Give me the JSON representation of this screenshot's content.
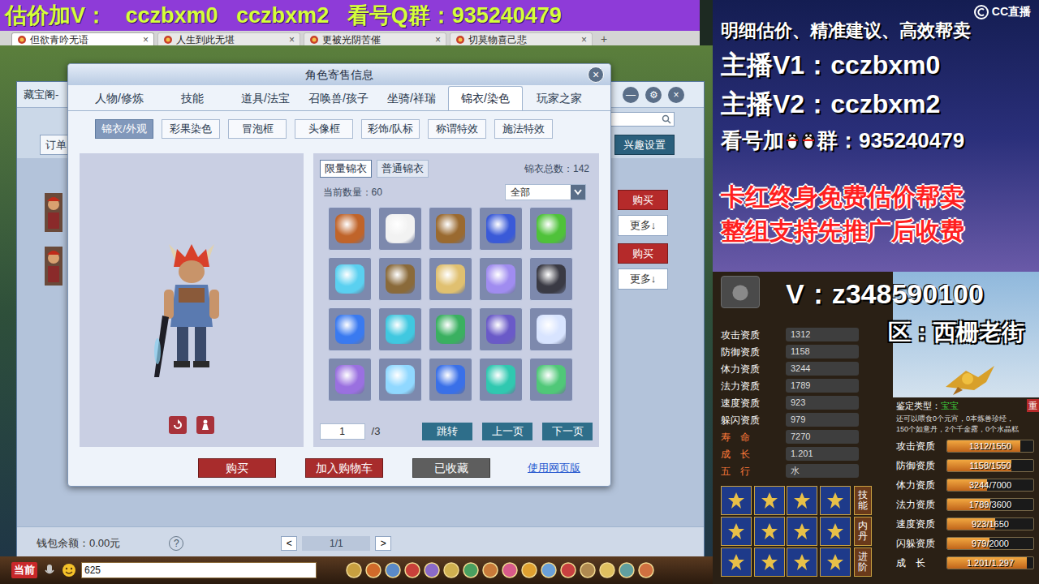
{
  "banner": "估价加V：   cczbxm0   cczbxm2   看号Q群：935240479",
  "browser_tabs": [
    {
      "label": "但欲青吟无语",
      "close": "×",
      "selected": true
    },
    {
      "label": "人生到此无堪",
      "close": "×",
      "selected": false
    },
    {
      "label": "更被光阴苦催",
      "close": "×",
      "selected": false
    },
    {
      "label": "切莫物喜己悲",
      "close": "×",
      "selected": false
    }
  ],
  "new_tab": "+",
  "trade_window": {
    "title": "藏宝阁-",
    "controls": [
      "—",
      "⚙",
      "×"
    ],
    "order": "订单",
    "interest": "兴趣设置",
    "listings": [
      {
        "buy": "购买",
        "more": "更多↓"
      },
      {
        "buy": "购买",
        "more": "更多↓"
      }
    ],
    "wallet": "钱包余额：0.00元",
    "help": "?",
    "pager": {
      "prev": "<",
      "page": "1/1",
      "next": ">"
    }
  },
  "dialog": {
    "title": "角色寄售信息",
    "close": "×",
    "tabs": [
      {
        "label": "人物/修炼",
        "selected": false
      },
      {
        "label": "技能",
        "selected": false
      },
      {
        "label": "道具/法宝",
        "selected": false
      },
      {
        "label": "召唤兽/孩子",
        "selected": false
      },
      {
        "label": "坐骑/祥瑞",
        "selected": false
      },
      {
        "label": "锦衣/染色",
        "selected": true
      },
      {
        "label": "玩家之家",
        "selected": false
      }
    ],
    "subtabs": [
      {
        "label": "锦衣/外观",
        "selected": true
      },
      {
        "label": "彩果染色",
        "selected": false
      },
      {
        "label": "冒泡框",
        "selected": false
      },
      {
        "label": "头像框",
        "selected": false
      },
      {
        "label": "彩饰/队标",
        "selected": false
      },
      {
        "label": "称谓特效",
        "selected": false
      },
      {
        "label": "施法特效",
        "selected": false
      }
    ],
    "outfit_types": [
      {
        "label": "限量锦衣",
        "selected": true
      },
      {
        "label": "普通锦衣",
        "selected": false
      }
    ],
    "total": "锦衣总数：142",
    "current": "当前数量：60",
    "filter": "全部",
    "items": [
      {
        "color": "#c0642a"
      },
      {
        "color": "#f2f2f2"
      },
      {
        "color": "#9a6a30"
      },
      {
        "color": "#3a5ad8"
      },
      {
        "color": "#4fc23a"
      },
      {
        "color": "#5ad0f0"
      },
      {
        "color": "#8a6a3a"
      },
      {
        "color": "#e0c070"
      },
      {
        "color": "#a08cf0"
      },
      {
        "color": "#3a3a44"
      },
      {
        "color": "#3a7af0"
      },
      {
        "color": "#40c8e0"
      },
      {
        "color": "#3ab060"
      },
      {
        "color": "#6a5ac8"
      },
      {
        "color": "#d8e4ff"
      },
      {
        "color": "#9a70e0"
      },
      {
        "color": "#90d8ff"
      },
      {
        "color": "#3a70e8"
      },
      {
        "color": "#30c8b0"
      },
      {
        "color": "#50c878"
      }
    ],
    "page_input": "1",
    "page_total": "/3",
    "jump": "跳转",
    "prev": "上一页",
    "next": "下一页",
    "actions": [
      {
        "label": "购买",
        "kind": "primary"
      },
      {
        "label": "加入购物车",
        "kind": "primary"
      },
      {
        "label": "已收藏",
        "kind": "muted"
      }
    ],
    "web_link": "使用网页版"
  },
  "taskbar": {
    "label": "当前",
    "value": "625"
  },
  "stream": {
    "logo": "CC直播",
    "headline": "明细估价、精准建议、高效帮卖",
    "anchors": [
      "主播V1：cczbxm0",
      "主播V2：cczbxm2"
    ],
    "group": {
      "prefix": "看号加",
      "suffix": "群：935240479"
    },
    "promos": [
      "卡红终身免费估价帮卖",
      "整组支持先推广后收费"
    ],
    "contact": "V：z348590100",
    "server": "区：西栅老街"
  },
  "pet": {
    "stats": [
      {
        "label": "攻击资质",
        "value": "1312",
        "kind": "aptitude"
      },
      {
        "label": "防御资质",
        "value": "1158",
        "kind": "aptitude"
      },
      {
        "label": "体力资质",
        "value": "3244",
        "kind": "aptitude"
      },
      {
        "label": "法力资质",
        "value": "1789",
        "kind": "aptitude"
      },
      {
        "label": "速度资质",
        "value": "923",
        "kind": "aptitude"
      },
      {
        "label": "躲闪资质",
        "value": "979",
        "kind": "aptitude"
      },
      {
        "label": "寿　命",
        "value": "7270",
        "kind": "basic"
      },
      {
        "label": "成　长",
        "value": "1.201",
        "kind": "basic"
      },
      {
        "label": "五　行",
        "value": "水",
        "kind": "basic"
      }
    ],
    "appraisal": {
      "label": "鉴定类型：",
      "value": "宝宝"
    },
    "corner": "重",
    "feed_lines": [
      "还可以喂食0个元宵，0本炼兽珍经，",
      "150个如意丹，2个千金露，0个水晶糕"
    ],
    "bars": [
      {
        "label": "攻击资质",
        "reading": "1312/1550",
        "level": 0.846
      },
      {
        "label": "防御资质",
        "reading": "1158/1550",
        "level": 0.747
      },
      {
        "label": "体力资质",
        "reading": "3244/7000",
        "level": 0.463
      },
      {
        "label": "法力资质",
        "reading": "1789/3600",
        "level": 0.497
      },
      {
        "label": "速度资质",
        "reading": "923/1650",
        "level": 0.559
      },
      {
        "label": "闪躲资质",
        "reading": "979/2000",
        "level": 0.49
      },
      {
        "label": "成　长",
        "reading": "1.201/1.297",
        "level": 0.926
      }
    ],
    "side_tabs": [
      "技能",
      "内丹",
      "进阶"
    ]
  }
}
